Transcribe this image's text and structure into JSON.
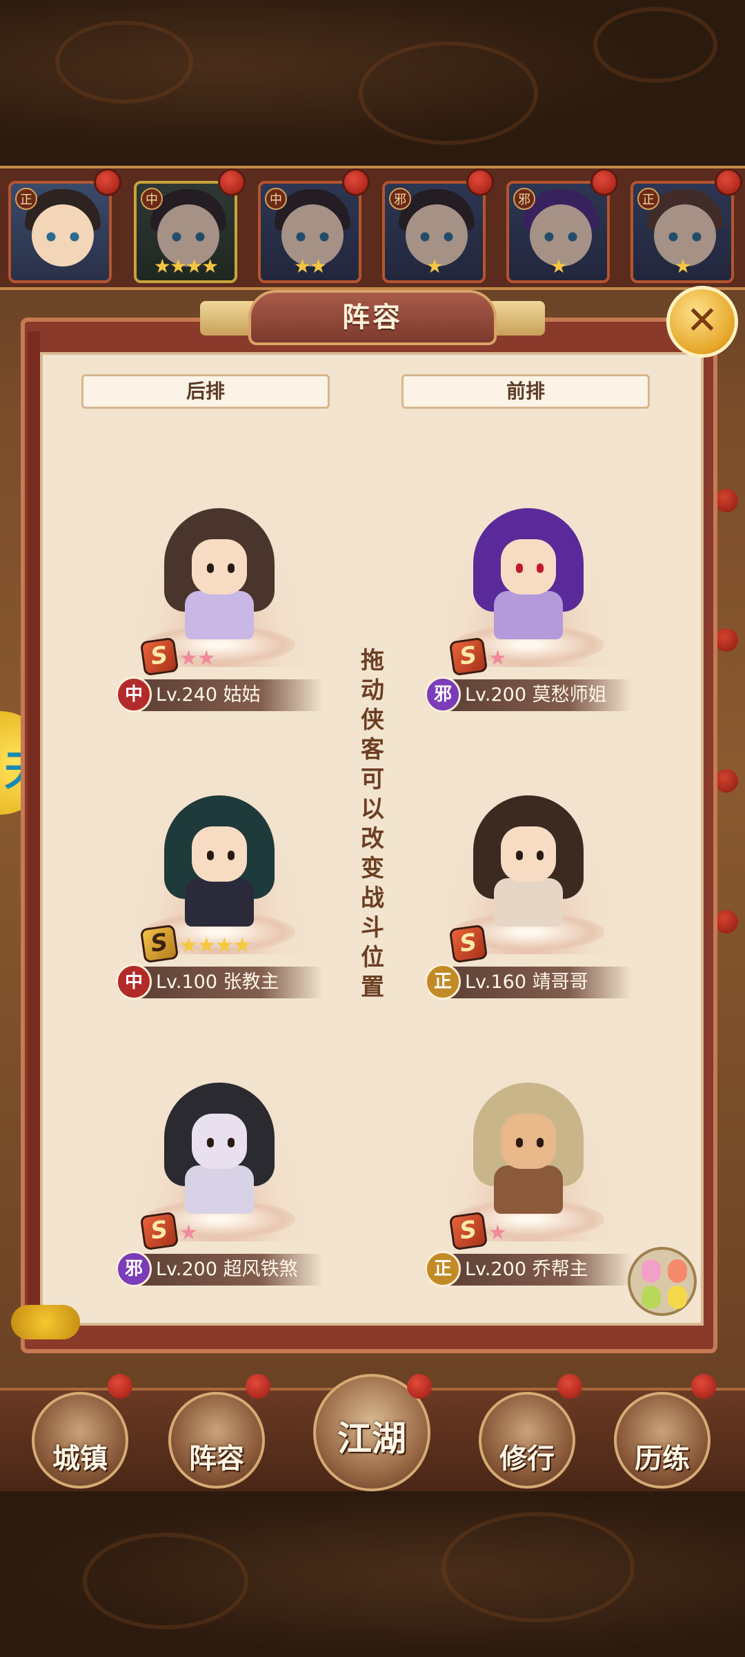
{
  "top_heroes": [
    {
      "faction": "正",
      "stars": "",
      "style": "red"
    },
    {
      "faction": "中",
      "stars": "★★★★",
      "style": "gold"
    },
    {
      "faction": "中",
      "stars": "★★",
      "style": "red"
    },
    {
      "faction": "邪",
      "stars": "★",
      "style": "red"
    },
    {
      "faction": "邪",
      "stars": "★",
      "style": "red"
    },
    {
      "faction": "正",
      "stars": "★",
      "style": "red"
    }
  ],
  "panel": {
    "title": "阵容",
    "close_glyph": "✕",
    "back_row_label": "后排",
    "front_row_label": "前排",
    "hint": "拖动侠客可以改变战斗位置"
  },
  "slots": [
    {
      "id": "guguo",
      "faction": "中",
      "faction_class": "zhong",
      "rank": "S",
      "stars": "★★",
      "level_text": "Lv.240 姑姑",
      "hair_color": "#4a352c",
      "body_color": "#c9b7e6"
    },
    {
      "id": "mochou",
      "faction": "邪",
      "faction_class": "xie",
      "rank": "S",
      "stars": "★",
      "level_text": "Lv.200 莫愁师姐",
      "hair_color": "#5a2a9a",
      "body_color": "#b49ad8"
    },
    {
      "id": "zhang",
      "faction": "中",
      "faction_class": "zhong",
      "rank": "S",
      "stars": "★★★★",
      "level_text": "Lv.100 张教主",
      "hair_color": "#1f3a3a",
      "body_color": "#2a2a3a",
      "gold": true
    },
    {
      "id": "jingge",
      "faction": "正",
      "faction_class": "zheng",
      "rank": "S",
      "stars": "",
      "level_text": "Lv.160 靖哥哥",
      "hair_color": "#3a2a20",
      "body_color": "#e6d6c6"
    },
    {
      "id": "chaofeng",
      "faction": "邪",
      "faction_class": "xie",
      "rank": "S",
      "stars": "★",
      "level_text": "Lv.200 超风铁煞",
      "hair_color": "#2a2a30",
      "body_color": "#d8d2e6"
    },
    {
      "id": "qiao",
      "faction": "正",
      "faction_class": "zheng",
      "rank": "S",
      "stars": "★",
      "level_text": "Lv.200 乔帮主",
      "hair_color": "#c8b68a",
      "body_color": "#8a5a3a"
    }
  ],
  "side_tab_glyph": "天",
  "nav": [
    {
      "label": "城镇"
    },
    {
      "label": "阵容"
    },
    {
      "label": "江湖"
    },
    {
      "label": "修行"
    },
    {
      "label": "历练"
    }
  ],
  "colors": {
    "accent_gold": "#e5a628",
    "panel_bg": "#f2e4cf",
    "frame_red": "#8a3a2a"
  }
}
